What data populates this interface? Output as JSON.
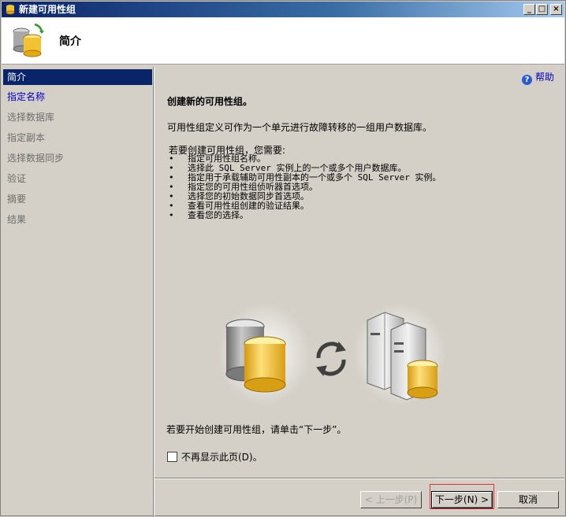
{
  "window": {
    "title": "新建可用性组",
    "min_glyph": "_",
    "max_glyph": "□",
    "close_glyph": "×"
  },
  "header": {
    "title": "简介"
  },
  "sidebar": {
    "items": [
      {
        "label": "简介",
        "state": "active"
      },
      {
        "label": "指定名称",
        "state": "link"
      },
      {
        "label": "选择数据库",
        "state": "disabled"
      },
      {
        "label": "指定副本",
        "state": "disabled"
      },
      {
        "label": "选择数据同步",
        "state": "disabled"
      },
      {
        "label": "验证",
        "state": "disabled"
      },
      {
        "label": "摘要",
        "state": "disabled"
      },
      {
        "label": "结果",
        "state": "disabled"
      }
    ]
  },
  "content": {
    "help_label": "帮助",
    "heading": "创建新的可用性组。",
    "description": "可用性组定义可作为一个单元进行故障转移的一组用户数据库。",
    "intro": "若要创建可用性组，您需要:",
    "steps": [
      "指定可用性组名称。",
      "选择此 SQL Server 实例上的一个或多个用户数据库。",
      "指定用于承载辅助可用性副本的一个或多个 SQL Server 实例。",
      "指定您的可用性组侦听器首选项。",
      "选择您的初始数据同步首选项。",
      "查看可用性组创建的验证结果。",
      "查看您的选择。"
    ],
    "start_text": "若要开始创建可用性组，请单击“下一步”。",
    "dont_show_label": "不再显示此页(D)。",
    "dont_show_checked": false
  },
  "buttons": {
    "prev": "< 上一步(P)",
    "next": "下一步(N) >",
    "cancel": "取消"
  },
  "colors": {
    "accent_selection": "#0a246a",
    "link": "#0000cc",
    "highlight_box": "#e03030"
  }
}
